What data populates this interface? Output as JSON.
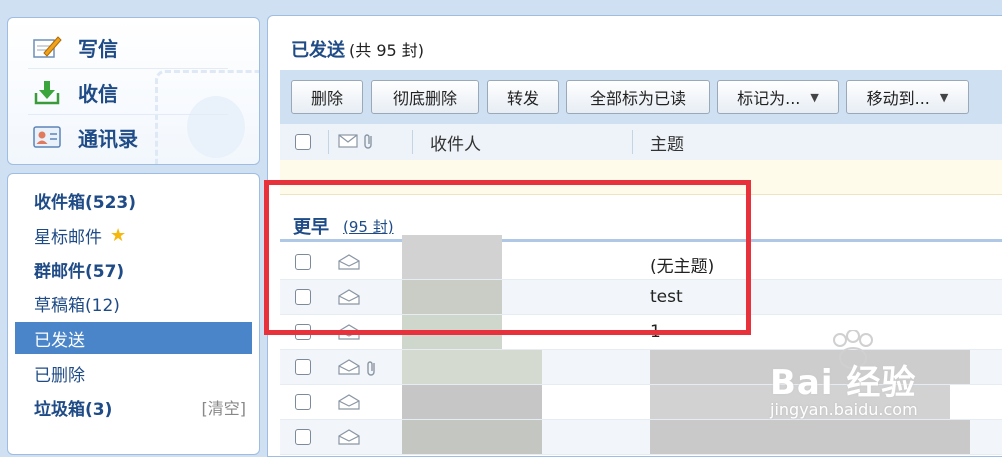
{
  "quick_actions": {
    "compose": "写信",
    "inbox": "收信",
    "contacts": "通讯录"
  },
  "folders": {
    "inbox": "收件箱(523)",
    "starred": "星标邮件",
    "group_mail": "群邮件(57)",
    "drafts": "草稿箱(12)",
    "sent": "已发送",
    "deleted": "已删除",
    "spam": "垃圾箱(3)",
    "spam_clear": "[清空]"
  },
  "main": {
    "title": "已发送",
    "count": "(共 95 封)"
  },
  "toolbar": {
    "delete": "删除",
    "delete_permanent": "彻底删除",
    "forward": "转发",
    "mark_all_read": "全部标为已读",
    "mark_as": "标记为...",
    "move_to": "移动到..."
  },
  "list_header": {
    "recipient": "收件人",
    "subject": "主题"
  },
  "group": {
    "title": "更早",
    "count": "(95 封)"
  },
  "rows": [
    {
      "subject": "(无主题)",
      "attachment": false
    },
    {
      "subject": "test",
      "attachment": false
    },
    {
      "subject": "1",
      "attachment": false
    },
    {
      "subject": "",
      "attachment": true
    },
    {
      "subject": "",
      "attachment": false
    },
    {
      "subject": "",
      "attachment": false
    }
  ],
  "watermark": {
    "brand": "Bai 经验",
    "url": "jingyan.baidu.com"
  },
  "colors": {
    "accent": "#1f4b86",
    "selected_folder": "#4a85c9",
    "highlight_box": "#e8323b"
  }
}
